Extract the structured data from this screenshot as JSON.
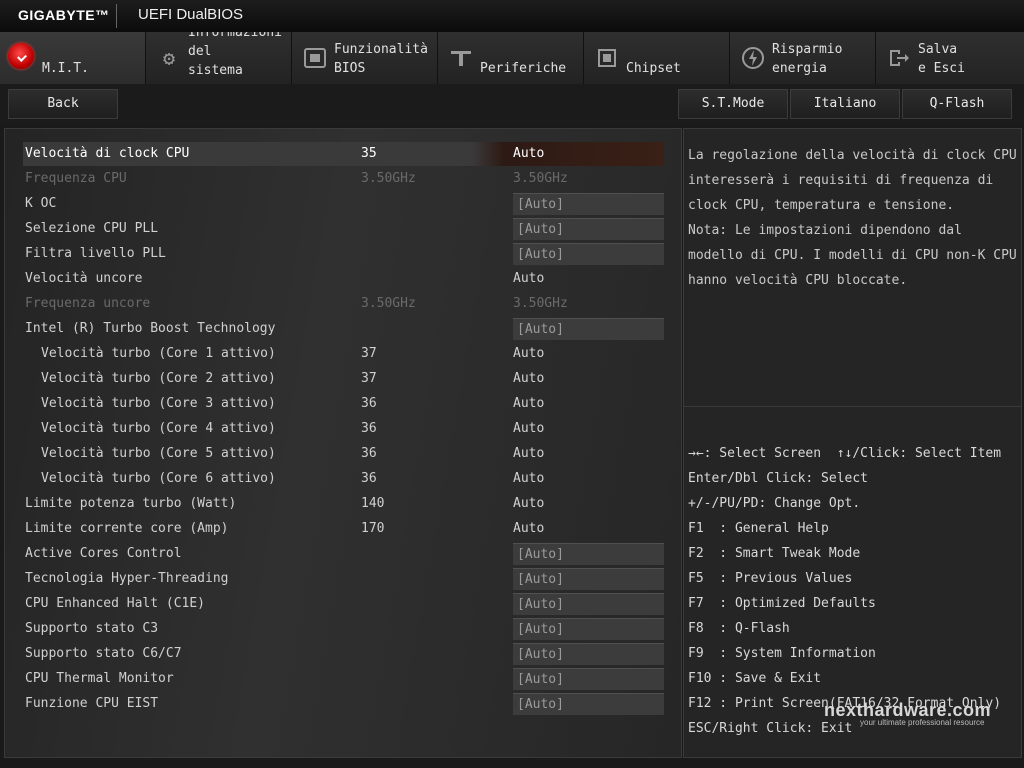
{
  "header": {
    "brand": "GIGABYTE™",
    "product": "UEFI DualBIOS"
  },
  "tabs": [
    {
      "label": "M.I.T.",
      "icon": "mit-icon"
    },
    {
      "label": "Informazioni\ndel\nsistema",
      "icon": "gear-icon"
    },
    {
      "label": "Funzionalità\nBIOS",
      "icon": "bios-icon"
    },
    {
      "label": "Periferiche",
      "icon": "peripherals-icon"
    },
    {
      "label": "Chipset",
      "icon": "chipset-icon"
    },
    {
      "label": "Risparmio\nenergia",
      "icon": "power-icon"
    },
    {
      "label": "Salva\ne Esci",
      "icon": "exit-icon"
    }
  ],
  "buttons": {
    "back": "Back",
    "mode": "S.T.Mode",
    "language": "Italiano",
    "qflash": "Q-Flash"
  },
  "settings": [
    {
      "name": "Velocità di clock CPU",
      "value": "35",
      "option": "Auto"
    },
    {
      "name": "Frequenza CPU",
      "value": "3.50GHz",
      "option": "3.50GHz"
    },
    {
      "name": "K OC",
      "value": "",
      "option": "[Auto]"
    },
    {
      "name": "Selezione CPU PLL",
      "value": "",
      "option": "[Auto]"
    },
    {
      "name": "Filtra livello PLL",
      "value": "",
      "option": "[Auto]"
    },
    {
      "name": "Velocità uncore",
      "value": "",
      "option": "Auto"
    },
    {
      "name": "Frequenza uncore",
      "value": "3.50GHz",
      "option": "3.50GHz"
    },
    {
      "name": "Intel (R) Turbo Boost Technology",
      "value": "",
      "option": "[Auto]"
    },
    {
      "name": "Velocità turbo (Core 1 attivo)",
      "value": "37",
      "option": "Auto"
    },
    {
      "name": "Velocità turbo (Core 2 attivo)",
      "value": "37",
      "option": "Auto"
    },
    {
      "name": "Velocità turbo (Core 3 attivo)",
      "value": "36",
      "option": "Auto"
    },
    {
      "name": "Velocità turbo (Core 4 attivo)",
      "value": "36",
      "option": "Auto"
    },
    {
      "name": "Velocità turbo (Core 5 attivo)",
      "value": "36",
      "option": "Auto"
    },
    {
      "name": "Velocità turbo (Core 6 attivo)",
      "value": "36",
      "option": "Auto"
    },
    {
      "name": "Limite potenza turbo (Watt)",
      "value": "140",
      "option": "Auto"
    },
    {
      "name": "Limite corrente core (Amp)",
      "value": "170",
      "option": "Auto"
    },
    {
      "name": "Active Cores Control",
      "value": "",
      "option": "[Auto]"
    },
    {
      "name": "Tecnologia Hyper-Threading",
      "value": "",
      "option": "[Auto]"
    },
    {
      "name": "CPU Enhanced Halt (C1E)",
      "value": "",
      "option": "[Auto]"
    },
    {
      "name": "Supporto stato C3",
      "value": "",
      "option": "[Auto]"
    },
    {
      "name": "Supporto stato C6/C7",
      "value": "",
      "option": "[Auto]"
    },
    {
      "name": "CPU Thermal Monitor",
      "value": "",
      "option": "[Auto]"
    },
    {
      "name": "Funzione CPU EIST",
      "value": "",
      "option": "[Auto]"
    }
  ],
  "help_text": "La regolazione della velocità di clock CPU interesserà i requisiti di frequenza di clock CPU, temperatura e tensione.\nNota: Le impostazioni dipendono dal modello di CPU. I modelli di CPU non-K CPU hanno velocità CPU bloccate.",
  "key_help": [
    "→←: Select Screen  ↑↓/Click: Select Item",
    "Enter/Dbl Click: Select",
    "+/-/PU/PD: Change Opt.",
    "F1  : General Help",
    "F2  : Smart Tweak Mode",
    "F5  : Previous Values",
    "F7  : Optimized Defaults",
    "F8  : Q-Flash",
    "F9  : System Information",
    "F10 : Save & Exit",
    "F12 : Print Screen(FAT16/32 Format Only)",
    "ESC/Right Click: Exit"
  ],
  "watermark": {
    "name": "nexthardware.com",
    "tagline": "your ultimate professional resource"
  }
}
